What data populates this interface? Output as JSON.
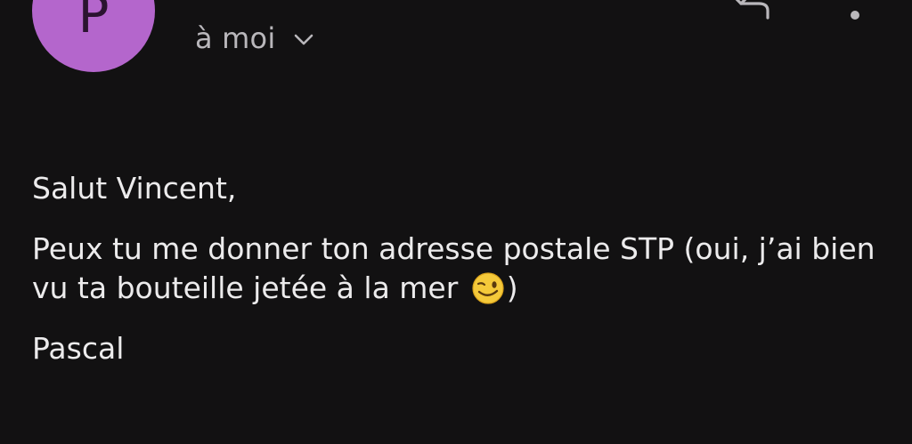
{
  "sender": {
    "avatar_letter": "P",
    "avatar_color": "#b466cc"
  },
  "recipient_line": {
    "label": "à moi",
    "chevron_icon": "chevron-down-icon"
  },
  "toolbar": {
    "reply_icon": "reply-icon",
    "more_icon": "more-vert-icon"
  },
  "message": {
    "greeting": "Salut Vincent,",
    "body_text": "Peux tu me donner ton adresse postale STP (oui, j’ai bien vu ta bouteille jetée à la mer ",
    "emoji_icon": "winking-face-emoji",
    "body_tail": ")",
    "signature": "Pascal"
  },
  "colors": {
    "background": "#121112",
    "text": "#ecebec",
    "secondary_text": "#b9b7bb"
  }
}
